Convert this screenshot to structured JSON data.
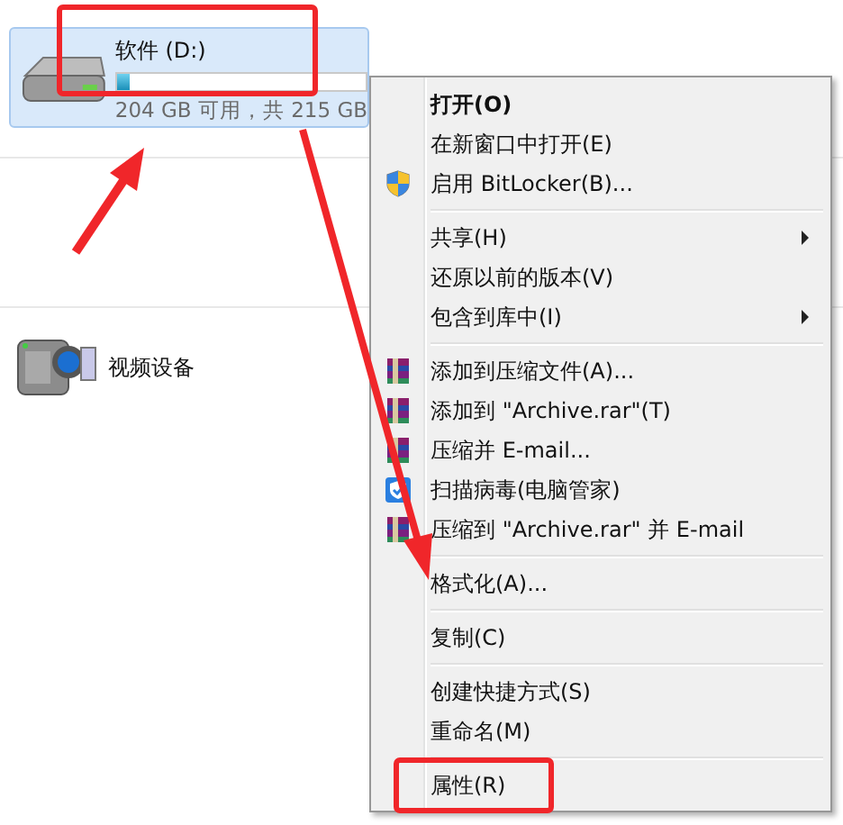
{
  "drive": {
    "name": "软件 (D:)",
    "level": 0.05,
    "space": "204 GB 可用，共 215 GB",
    "selected": true
  },
  "devices": [
    {
      "label": "视频设备"
    }
  ],
  "menu": [
    [
      {
        "label": "打开(O)",
        "default": true,
        "submenu": false
      },
      {
        "label": "在新窗口中打开(E)",
        "default": false,
        "submenu": false
      },
      {
        "label": "启用 BitLocker(B)...",
        "kind": "shield",
        "default": false,
        "submenu": false
      }
    ],
    [
      {
        "label": "共享(H)",
        "default": false,
        "submenu": true
      },
      {
        "label": "还原以前的版本(V)",
        "default": false,
        "submenu": false
      },
      {
        "label": "包含到库中(I)",
        "default": false,
        "submenu": true
      }
    ],
    [
      {
        "label": "添加到压缩文件(A)...",
        "kind": "archive",
        "default": false,
        "submenu": false
      },
      {
        "label": "添加到 \"Archive.rar\"(T)",
        "kind": "archive",
        "default": false,
        "submenu": false
      },
      {
        "label": "压缩并 E-mail...",
        "kind": "archive",
        "default": false,
        "submenu": false
      },
      {
        "label": "扫描病毒(电脑管家)",
        "kind": "guard",
        "default": false,
        "submenu": false
      },
      {
        "label": "压缩到 \"Archive.rar\" 并 E-mail",
        "kind": "archive",
        "default": false,
        "submenu": false
      }
    ],
    [
      {
        "label": "格式化(A)...",
        "default": false,
        "submenu": false
      }
    ],
    [
      {
        "label": "复制(C)",
        "default": false,
        "submenu": false
      }
    ],
    [
      {
        "label": "创建快捷方式(S)",
        "default": false,
        "submenu": false
      },
      {
        "label": "重命名(M)",
        "default": false,
        "submenu": false
      }
    ],
    [
      {
        "label": "属性(R)",
        "default": false,
        "submenu": false
      }
    ]
  ]
}
